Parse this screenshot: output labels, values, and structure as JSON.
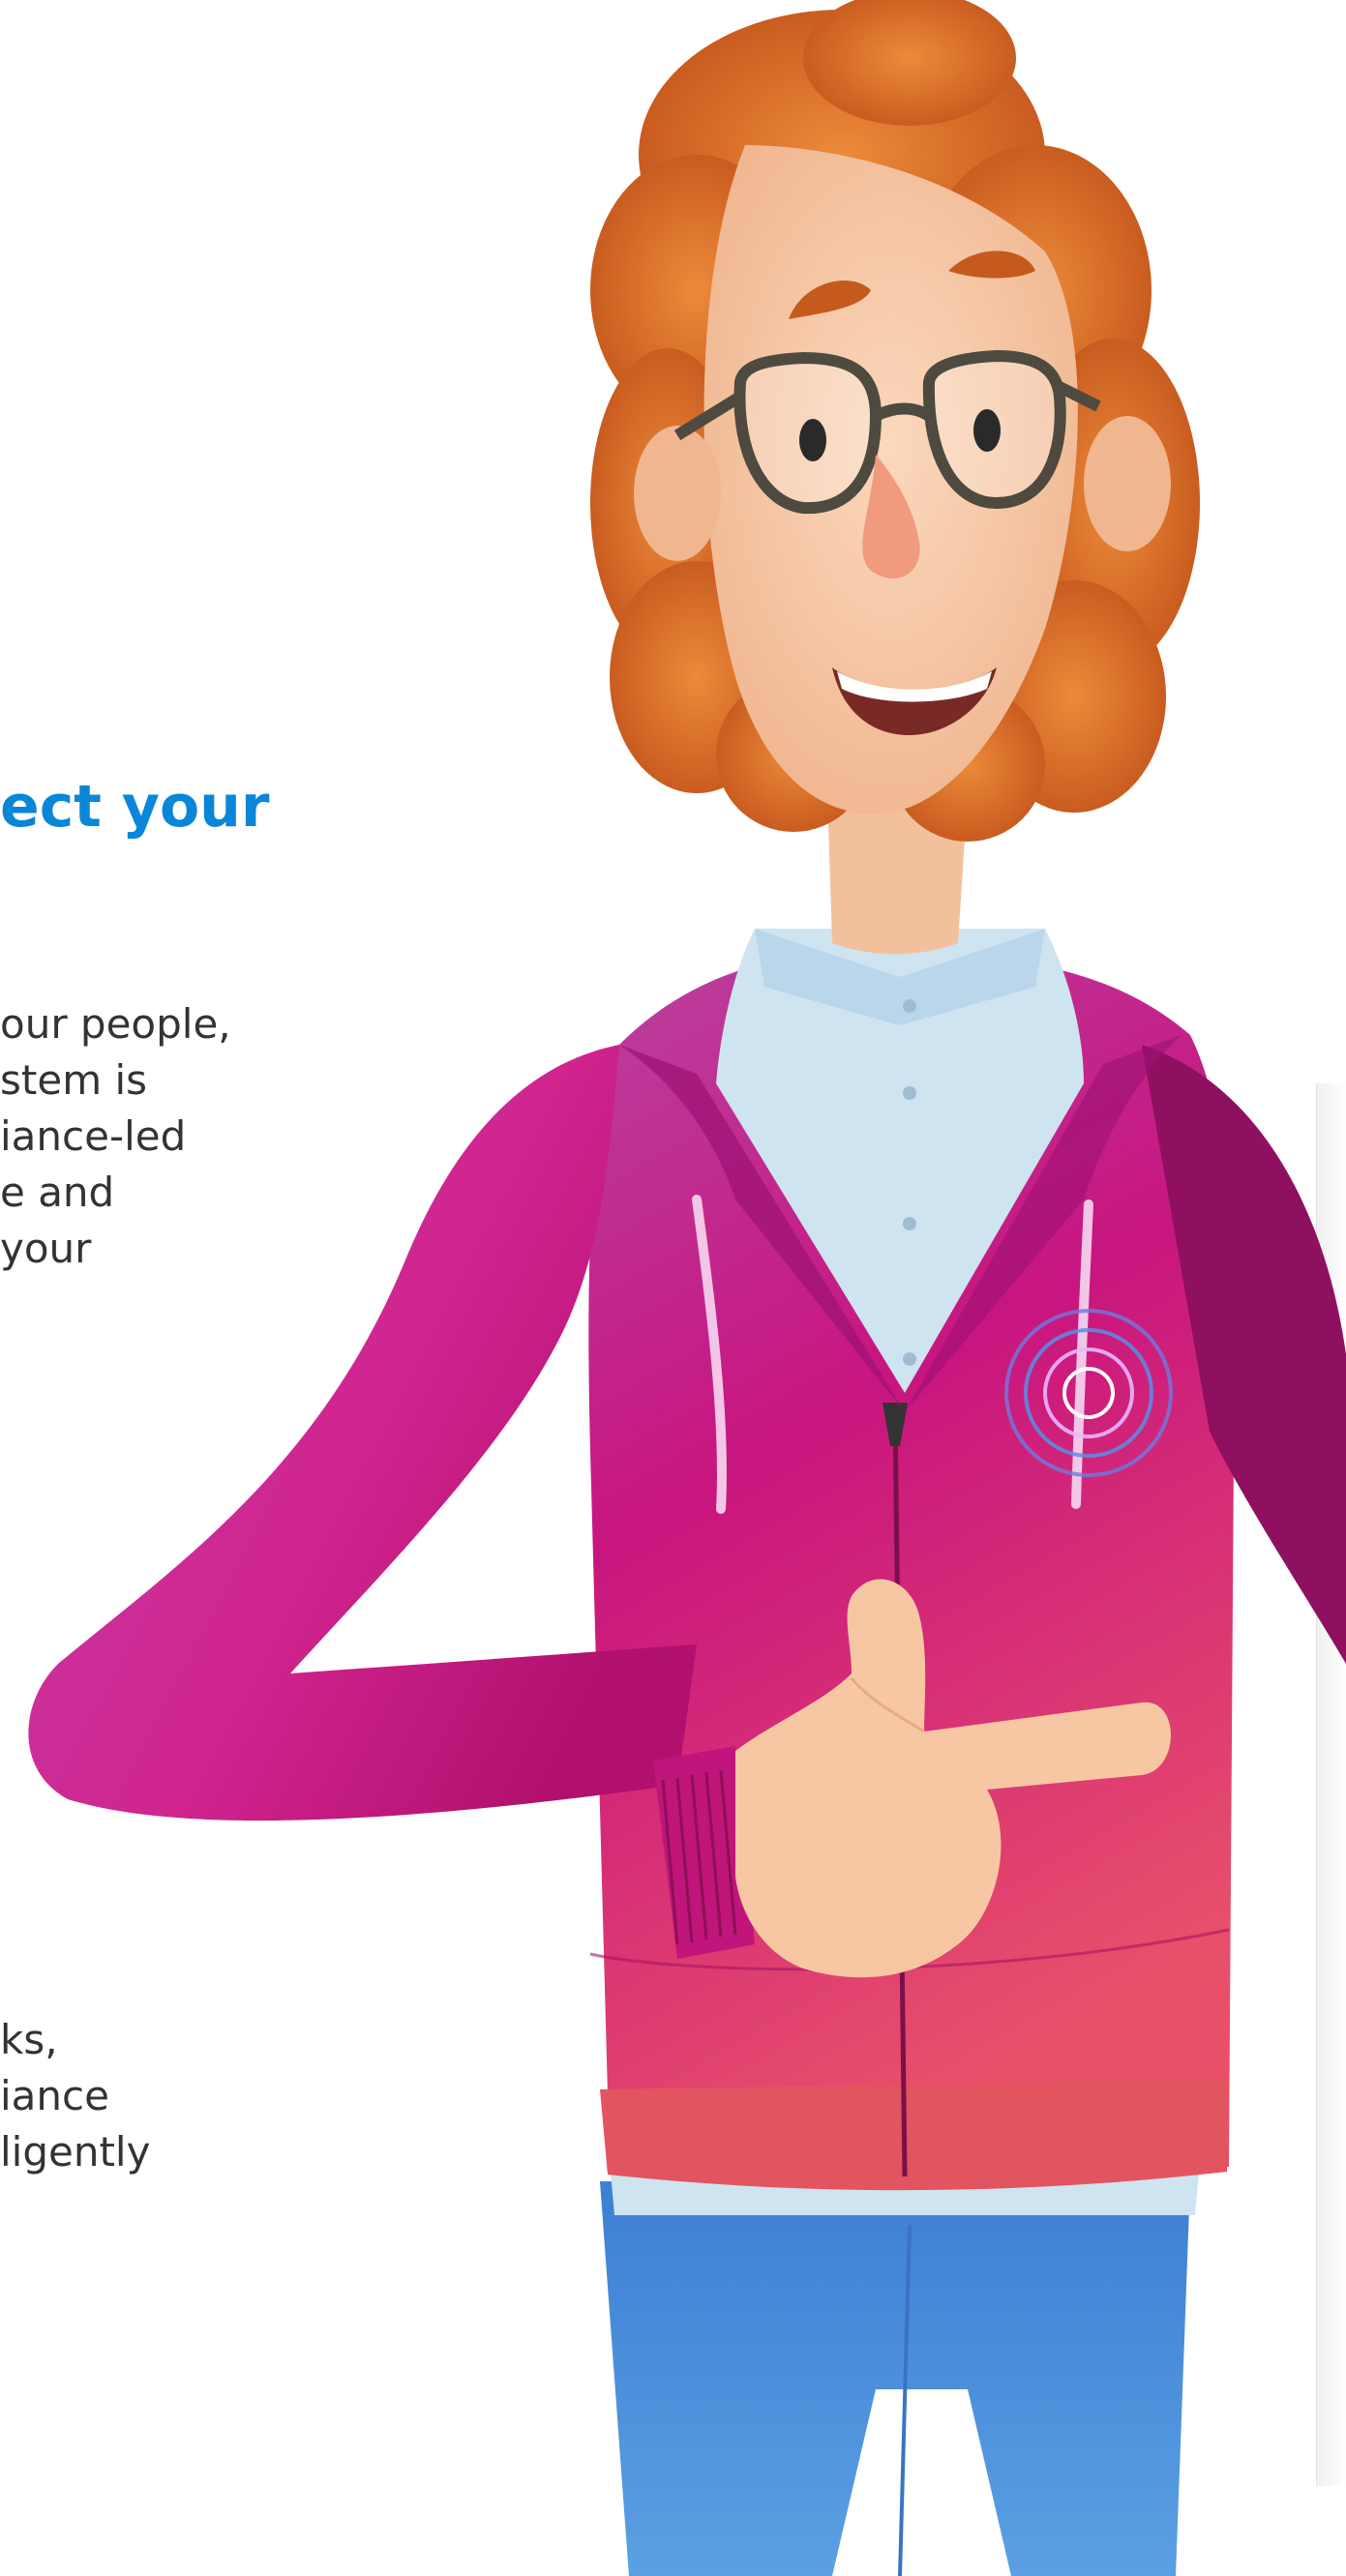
{
  "heading": {
    "fragment": "ect your"
  },
  "intro": {
    "lines": [
      "our people,",
      "stem is",
      "iance-led",
      "e and",
      "your"
    ]
  },
  "second_paragraph": {
    "lines": [
      "ks,",
      "iance",
      "ligently"
    ]
  },
  "colors": {
    "heading": "#0a86d9",
    "body_text": "#333333",
    "hoodie": "#c2187d",
    "shirt": "#cfe4f1",
    "jeans": "#4f8fd8",
    "hair": "#d96a22",
    "skin": "#f6c6a2"
  }
}
